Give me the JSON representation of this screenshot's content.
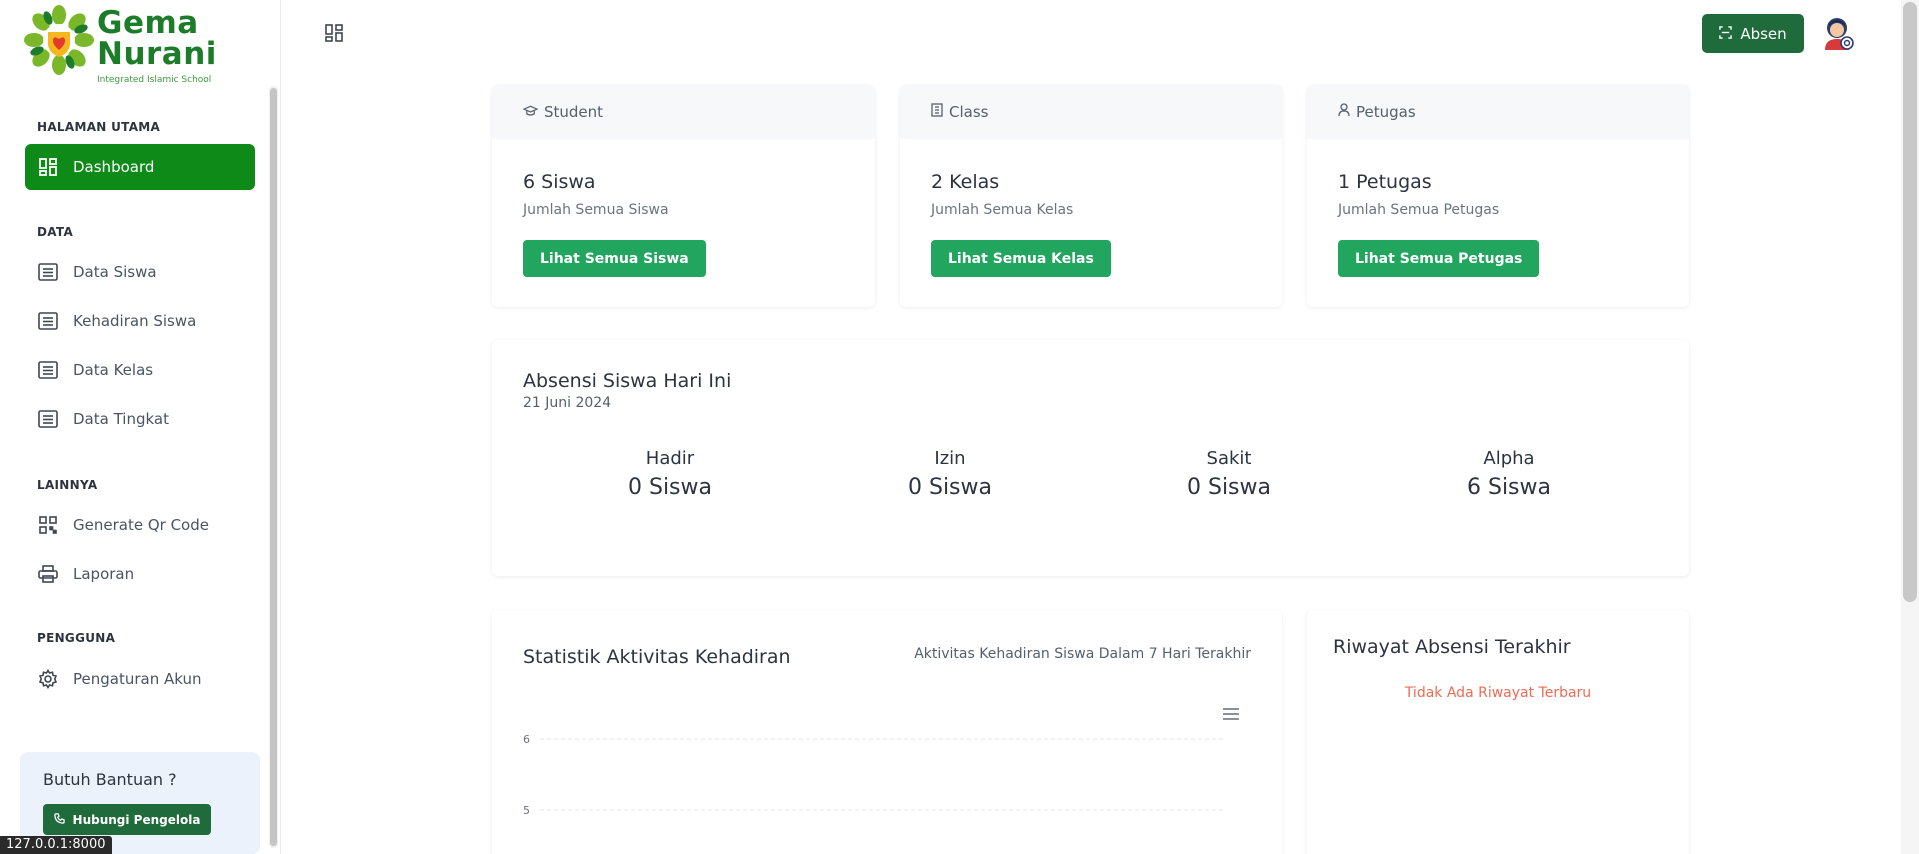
{
  "brand": {
    "name_line1": "Gema",
    "name_line2": "Nurani",
    "tagline": "Integrated Islamic School"
  },
  "sidebar": {
    "sections": [
      {
        "label": "HALAMAN UTAMA"
      },
      {
        "label": "DATA"
      },
      {
        "label": "LAINNYA"
      },
      {
        "label": "PENGGUNA"
      }
    ],
    "items": [
      {
        "label": "Dashboard",
        "icon": "dashboard-icon",
        "active": true
      },
      {
        "label": "Data Siswa",
        "icon": "list-icon"
      },
      {
        "label": "Kehadiran Siswa",
        "icon": "list-icon"
      },
      {
        "label": "Data Kelas",
        "icon": "list-icon"
      },
      {
        "label": "Data Tingkat",
        "icon": "list-icon"
      },
      {
        "label": "Generate Qr Code",
        "icon": "qr-code-icon"
      },
      {
        "label": "Laporan",
        "icon": "printer-icon"
      },
      {
        "label": "Pengaturan Akun",
        "icon": "gear-icon"
      }
    ],
    "help": {
      "title": "Butuh Bantuan ?",
      "button": "Hubungi Pengelola"
    }
  },
  "topbar": {
    "absen_label": "Absen"
  },
  "status_bar": {
    "url": "127.0.0.1:8000"
  },
  "stats": [
    {
      "header": "Student",
      "value": "6 Siswa",
      "sub": "Jumlah Semua Siswa",
      "button": "Lihat Semua Siswa",
      "icon": "graduation-cap-icon"
    },
    {
      "header": "Class",
      "value": "2 Kelas",
      "sub": "Jumlah Semua Kelas",
      "button": "Lihat Semua Kelas",
      "icon": "building-icon"
    },
    {
      "header": "Petugas",
      "value": "1 Petugas",
      "sub": "Jumlah Semua Petugas",
      "button": "Lihat Semua Petugas",
      "icon": "user-icon"
    }
  ],
  "attendance": {
    "title": "Absensi Siswa Hari Ini",
    "date": "21 Juni 2024",
    "columns": [
      {
        "label": "Hadir",
        "value": "0 Siswa"
      },
      {
        "label": "Izin",
        "value": "0 Siswa"
      },
      {
        "label": "Sakit",
        "value": "0 Siswa"
      },
      {
        "label": "Alpha",
        "value": "6 Siswa"
      }
    ]
  },
  "activity_chart": {
    "title": "Statistik Aktivitas Kehadiran",
    "subtitle": "Aktivitas Kehadiran Siswa Dalam 7 Hari Terakhir",
    "y_ticks": [
      "6",
      "5"
    ]
  },
  "history": {
    "title": "Riwayat Absensi Terakhir",
    "empty": "Tidak Ada Riwayat Terbaru"
  },
  "colors": {
    "brand_green": "#1d7c2a",
    "active_nav": "#0d8a17",
    "button_green": "#22a55e",
    "dark_green": "#1f6b3c",
    "empty_red": "#ee6b55"
  }
}
